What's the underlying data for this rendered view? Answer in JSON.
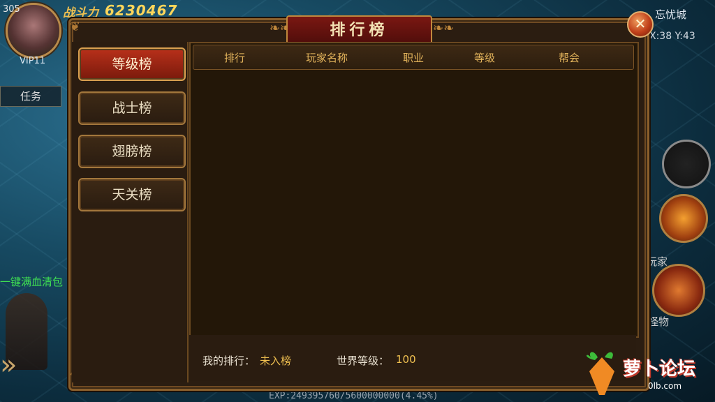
{
  "hud": {
    "level": "305",
    "vip": "VIP11",
    "power_label": "战斗力",
    "power_value": "6230467",
    "task_tab": "任务",
    "potion_text": "一键满血清包",
    "map_name": "忘忧城",
    "coords": "X:38 Y:43",
    "player_label": "玩家",
    "monster_label": "怪物",
    "exp": "EXP:249395760/5600000000(4.45%)"
  },
  "panel": {
    "title": "排行榜",
    "close_label": "✕",
    "tabs": [
      {
        "label": "等级榜",
        "active": true
      },
      {
        "label": "战士榜",
        "active": false
      },
      {
        "label": "翅膀榜",
        "active": false
      },
      {
        "label": "天关榜",
        "active": false
      }
    ],
    "columns": [
      "排行",
      "玩家名称",
      "职业",
      "等级",
      "帮会"
    ],
    "footer": {
      "my_rank_label": "我的排行：",
      "my_rank_value": "未入榜",
      "world_level_label": "世界等级：",
      "world_level_value": "100"
    }
  },
  "watermark": {
    "text": "萝卜论坛",
    "url": "0lb.com"
  }
}
